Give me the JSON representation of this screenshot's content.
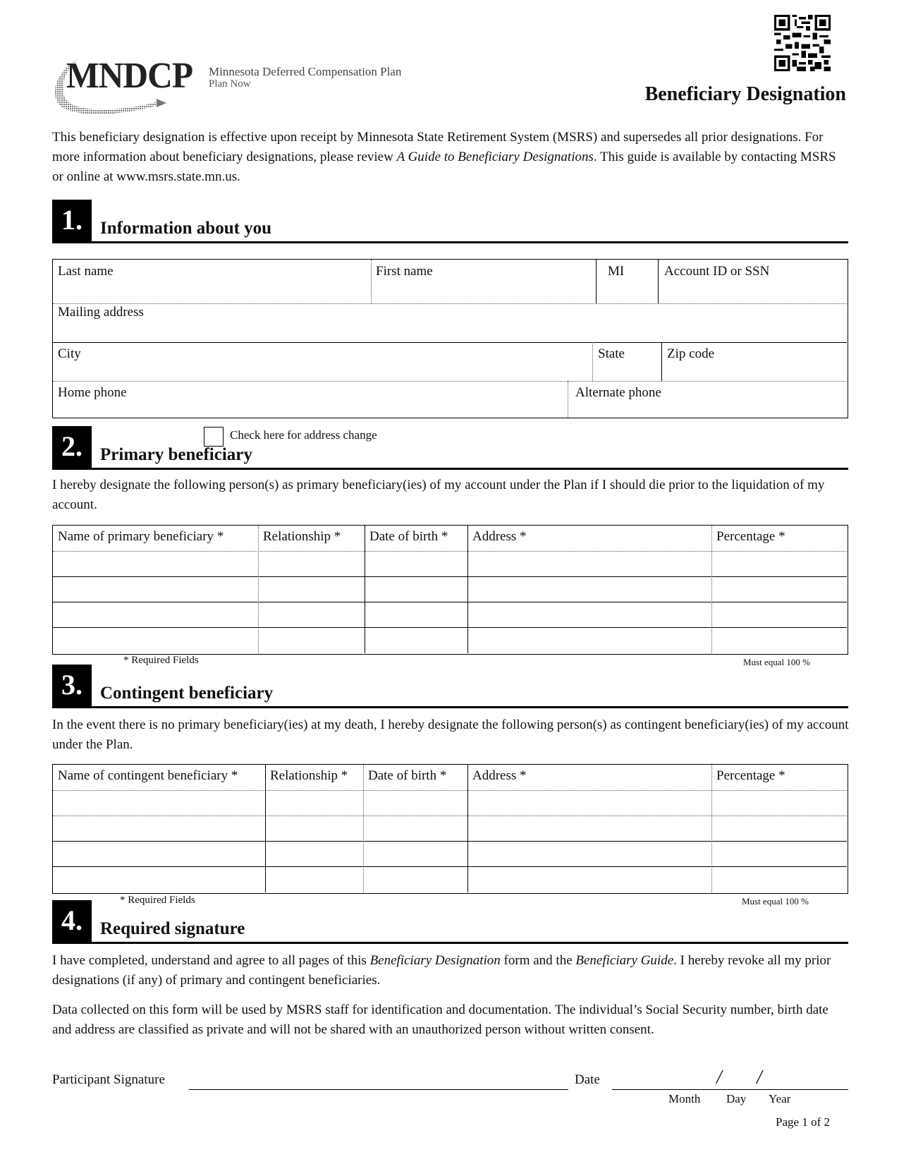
{
  "header": {
    "logo_acronym": "MNDCP",
    "logo_name": "Minnesota Deferred Compensation Plan",
    "logo_tagline": "Plan Now",
    "qr_icon": "qr-code-icon",
    "title": "Beneficiary Designation"
  },
  "intro": {
    "text_before_italic": "This beneficiary designation is effective upon receipt by Minnesota State Retirement System (MSRS) and supersedes all prior designations. For more information about beneficiary designations, please review ",
    "italic": "A Guide to Beneficiary Designations",
    "text_after_italic": ". This guide is available by contacting MSRS or online at www.msrs.state.mn.us."
  },
  "section1": {
    "number": "1.",
    "title": "Information about you",
    "fields": {
      "last_name": "Last name",
      "first_name": "First name",
      "mi": "MI",
      "account_id": "Account ID or SSN",
      "mailing_address": "Mailing address",
      "city": "City",
      "state": "State",
      "zip": "Zip code",
      "home_phone": "Home phone",
      "alternate_phone": "Alternate phone"
    },
    "address_change_label": "Check here for address change"
  },
  "section2": {
    "number": "2.",
    "title": "Primary beneficiary",
    "description": "I hereby designate the following person(s) as primary beneficiary(ies) of my account under the Plan if I should die prior to the liquidation of my account.",
    "columns": [
      "Name of primary beneficiary *",
      "Relationship *",
      "Date of birth *",
      "Address  *",
      "Percentage *"
    ],
    "row_count": 4,
    "required_note": "* Required Fields",
    "percent_note": "Must equal 100 %"
  },
  "section3": {
    "number": "3.",
    "title": "Contingent beneficiary",
    "description": "In the event there is no primary beneficiary(ies) at my death, I hereby designate the following person(s) as contingent beneficiary(ies) of my account under the Plan.",
    "columns": [
      "Name of contingent beneficiary *",
      "Relationship *",
      "Date of birth *",
      "Address *",
      "Percentage *"
    ],
    "row_count": 4,
    "required_note": "* Required Fields",
    "percent_note": "Must equal 100 %"
  },
  "section4": {
    "number": "4.",
    "title": "Required signature",
    "agree_before": "I have completed, understand and agree to all pages of this ",
    "agree_italic1": "Beneficiary Designation",
    "agree_mid": " form and the ",
    "agree_italic2": "Beneficiary Guide",
    "agree_after": ". I hereby revoke all my prior designations (if any) of primary and contingent beneficiaries.",
    "privacy": "Data collected on this form will be used by MSRS staff for identification and documentation. The individual’s Social Security number, birth date and address are classified as private and will not be shared with an unauthorized person without written consent.",
    "signature_label": "Participant Signature",
    "date_label": "Date",
    "date_sep": "/",
    "month_label": "Month",
    "day_label": "Day",
    "year_label": "Year"
  },
  "footer": {
    "page": "Page 1 of 2"
  }
}
